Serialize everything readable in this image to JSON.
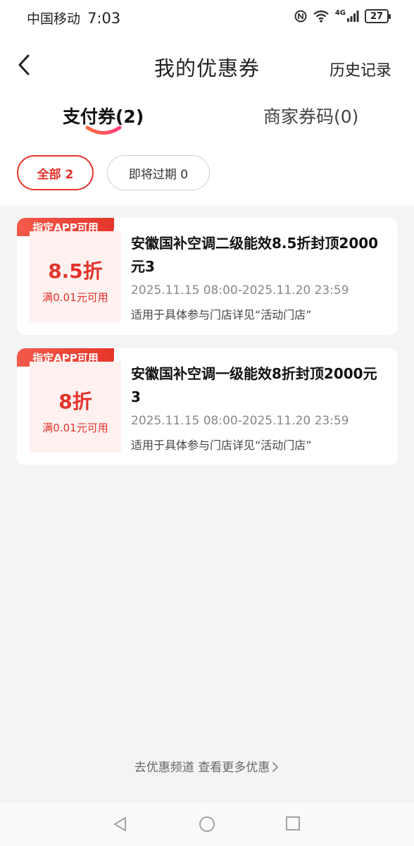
{
  "statusbar": {
    "carrier": "中国移动",
    "time": "7:03",
    "network": "4G",
    "battery": "27"
  },
  "header": {
    "title": "我的优惠券",
    "history_label": "历史记录"
  },
  "tabs": [
    {
      "label": "支付券(2)",
      "active": true
    },
    {
      "label": "商家券码(0)",
      "active": false
    }
  ],
  "filters": [
    {
      "label": "全部 2",
      "active": true
    },
    {
      "label": "即将过期 0",
      "active": false
    }
  ],
  "coupons": [
    {
      "badge": "指定APP可用",
      "value": "8.5折",
      "condition": "满0.01元可用",
      "title": "安徽国补空调二级能效8.5折封顶2000元3",
      "date_range": "2025.11.15 08:00-2025.11.20 23:59",
      "note": "适用于具体参与门店详见“活动门店”"
    },
    {
      "badge": "指定APP可用",
      "value": "8折",
      "condition": "满0.01元可用",
      "title": "安徽国补空调一级能效8折封顶2000元3",
      "date_range": "2025.11.15 08:00-2025.11.20 23:59",
      "note": "适用于具体参与门店详见“活动门店”"
    }
  ],
  "footer": {
    "more_label": "去优惠频道 查看更多优惠"
  },
  "colors": {
    "accent": "#e4342c",
    "coupon_bg": "#fff1f0",
    "page_bg": "#f4f4f4"
  },
  "icons": {
    "back": "chevron-left-icon",
    "more": "chevron-right-icon",
    "nav_back": "triangle-back-icon",
    "nav_home": "circle-home-icon",
    "nav_recents": "square-recents-icon"
  }
}
